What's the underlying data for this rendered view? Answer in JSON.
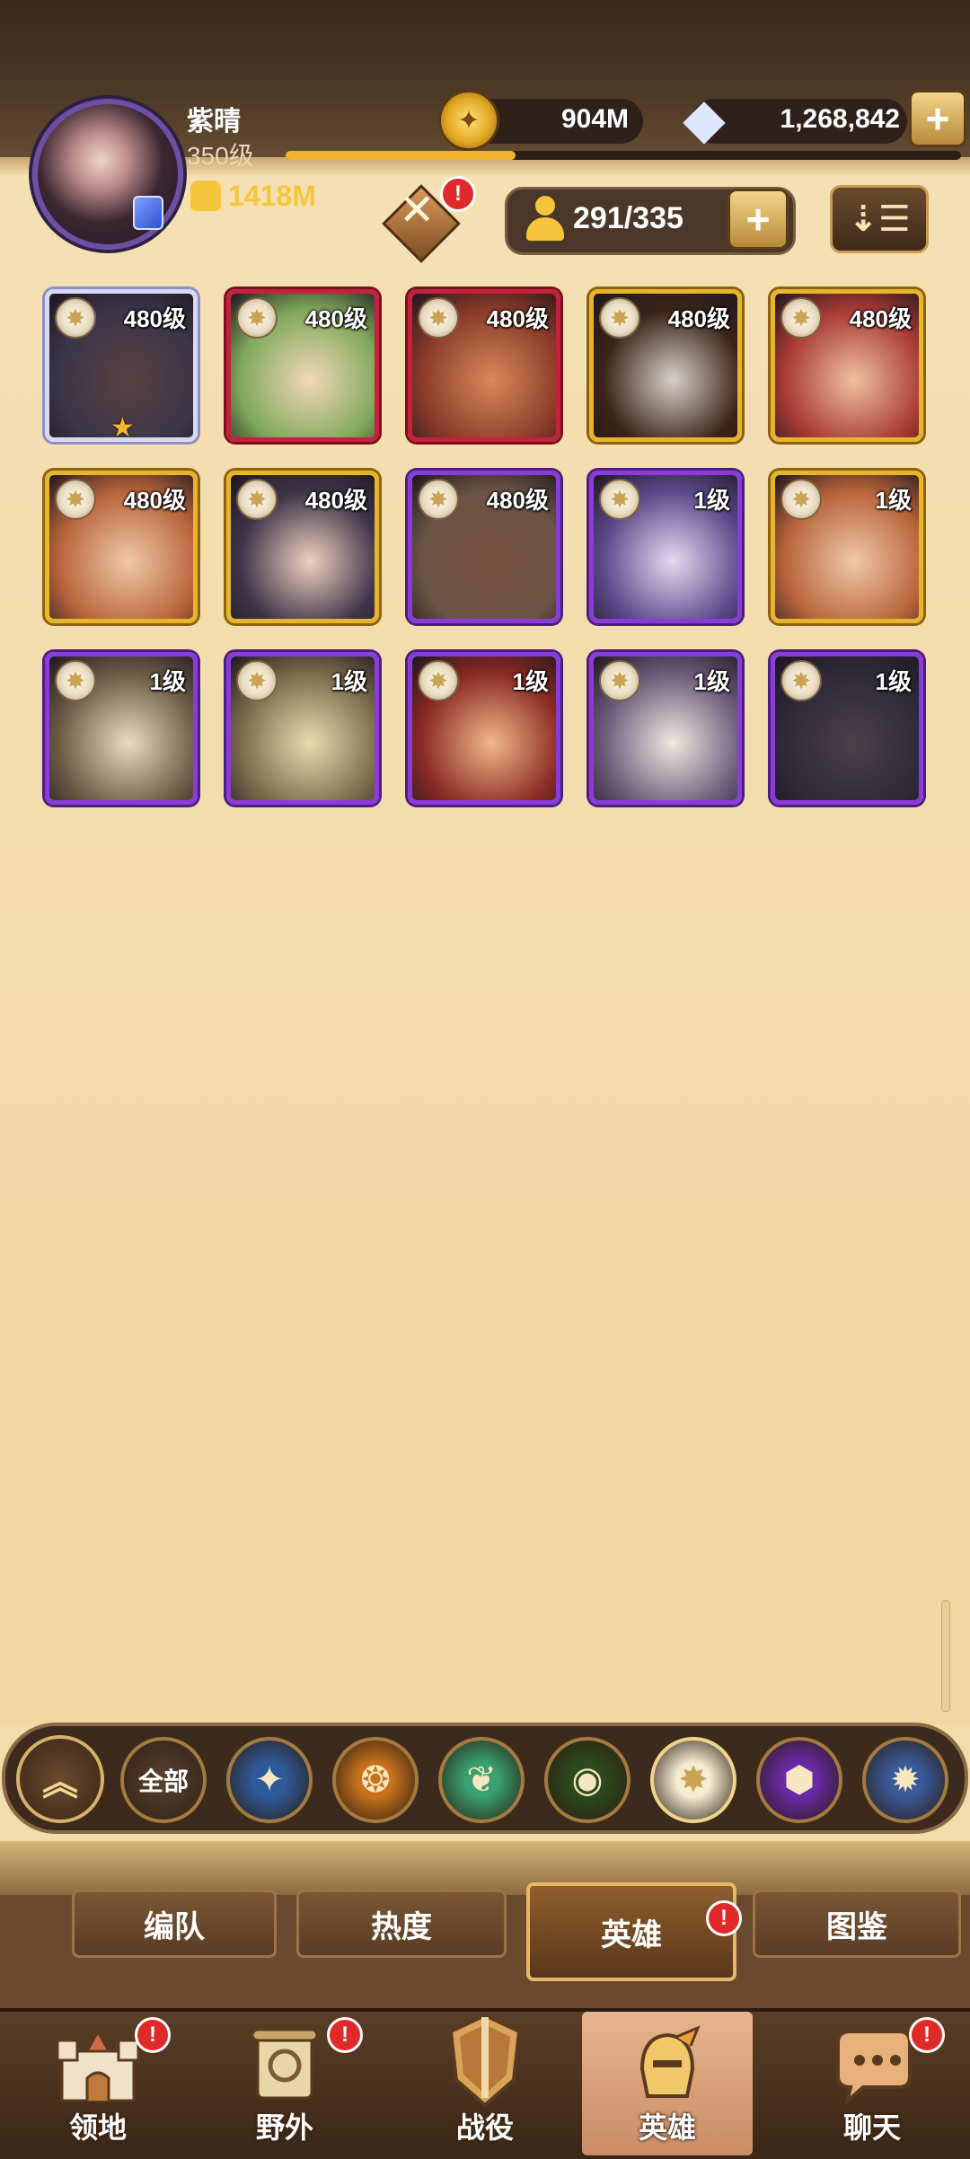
{
  "player": {
    "name": "紫晴",
    "level": "350级",
    "power": "1418M",
    "xp_progress": 0.34
  },
  "currency": {
    "gold": "904M",
    "gems": "1,268,842"
  },
  "hero_count": "291/335",
  "heroes": [
    {
      "level": "480级",
      "rarity": "white",
      "art": "#3a3548",
      "face": "#5a4040"
    },
    {
      "level": "480级",
      "rarity": "red",
      "art": "#7fa85a",
      "face": "#f2d8b8"
    },
    {
      "level": "480级",
      "rarity": "red",
      "art": "#8a3a28",
      "face": "#d88a5a"
    },
    {
      "level": "480级",
      "rarity": "gold",
      "art": "#3a2418",
      "face": "#d8d0c8"
    },
    {
      "level": "480级",
      "rarity": "gold",
      "art": "#a83a34",
      "face": "#f0c0a0"
    },
    {
      "level": "480级",
      "rarity": "gold",
      "art": "#b8643a",
      "face": "#f0c8a8"
    },
    {
      "level": "480级",
      "rarity": "gold",
      "art": "#3e3448",
      "face": "#f0d0c0"
    },
    {
      "level": "480级",
      "rarity": "purple",
      "art": "#6a5444",
      "face": "#7a5040"
    },
    {
      "level": "1级",
      "rarity": "purple",
      "art": "#5a4a8a",
      "face": "#e8d8f0"
    },
    {
      "level": "1级",
      "rarity": "gold",
      "art": "#b8643a",
      "face": "#f0c8a8"
    },
    {
      "level": "1级",
      "rarity": "purple",
      "art": "#6a5a44",
      "face": "#e8dcc0"
    },
    {
      "level": "1级",
      "rarity": "purple",
      "art": "#7a6a4a",
      "face": "#e8dcb0"
    },
    {
      "level": "1级",
      "rarity": "purple",
      "art": "#8a2a24",
      "face": "#f0b888"
    },
    {
      "level": "1级",
      "rarity": "purple",
      "art": "#6a5a78",
      "face": "#f0e8e0"
    },
    {
      "level": "1级",
      "rarity": "purple",
      "art": "#2e2a38",
      "face": "#4a4048"
    }
  ],
  "filter": {
    "all_label": "全部",
    "factions": [
      {
        "name": "lightbearer-icon",
        "color": "#2f5a9a"
      },
      {
        "name": "mauler-icon",
        "color": "#c8731c"
      },
      {
        "name": "wilder-icon",
        "color": "#3aa070"
      },
      {
        "name": "graveborn-icon",
        "color": "#2c4a1c"
      },
      {
        "name": "celestial-icon",
        "color": "#f6ecd2"
      },
      {
        "name": "hypogean-icon",
        "color": "#6a2aa8"
      },
      {
        "name": "dimensional-icon",
        "color": "#3a5a9a"
      }
    ]
  },
  "tabs": [
    "编队",
    "热度",
    "英雄",
    "图鉴"
  ],
  "nav": [
    {
      "label": "领地",
      "badge": "!"
    },
    {
      "label": "野外",
      "badge": "!"
    },
    {
      "label": "战役",
      "badge": ""
    },
    {
      "label": "英雄",
      "badge": ""
    },
    {
      "label": "聊天",
      "badge": "!"
    }
  ],
  "badge": "!"
}
